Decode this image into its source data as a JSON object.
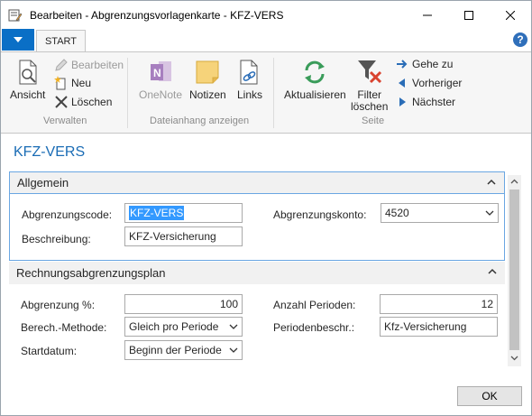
{
  "window": {
    "title": "Bearbeiten - Abgrenzungsvorlagenkarte - KFZ-VERS",
    "minimize_icon": "minimize-icon",
    "maximize_icon": "maximize-icon",
    "close_icon": "close-icon"
  },
  "ribbon": {
    "tabs": [
      {
        "label": "START",
        "active": true
      }
    ],
    "groups": {
      "verwalten": {
        "label": "Verwalten",
        "ansicht": "Ansicht",
        "bearbeiten": "Bearbeiten",
        "neu": "Neu",
        "loeschen": "Löschen"
      },
      "dateianhang": {
        "label": "Dateianhang anzeigen",
        "onenote": "OneNote",
        "notizen": "Notizen",
        "links": "Links"
      },
      "seite": {
        "label": "Seite",
        "aktualisieren": "Aktualisieren",
        "filter_loeschen_line1": "Filter",
        "filter_loeschen_line2": "löschen",
        "gehe_zu": "Gehe zu",
        "vorheriger": "Vorheriger",
        "naechster": "Nächster"
      }
    }
  },
  "page": {
    "title": "KFZ-VERS"
  },
  "sections": {
    "allgemein": {
      "header": "Allgemein",
      "abgrenzungscode_label": "Abgrenzungscode:",
      "abgrenzungscode_value": "KFZ-VERS",
      "beschreibung_label": "Beschreibung:",
      "beschreibung_value": "KFZ-Versicherung",
      "abgrenzungskonto_label": "Abgrenzungskonto:",
      "abgrenzungskonto_value": "4520"
    },
    "plan": {
      "header": "Rechnungsabgrenzungsplan",
      "abgrenzung_label": "Abgrenzung %:",
      "abgrenzung_value": "100",
      "berech_label": "Berech.-Methode:",
      "berech_value": "Gleich pro Periode",
      "startdatum_label": "Startdatum:",
      "startdatum_value": "Beginn der Periode",
      "anzahl_label": "Anzahl Perioden:",
      "anzahl_value": "12",
      "periodenbeschr_label": "Periodenbeschr.:",
      "periodenbeschr_value": "Kfz-Versicherung"
    }
  },
  "footer": {
    "ok_label": "OK"
  },
  "colors": {
    "accent_blue": "#0a6fc6",
    "title_blue": "#1a6cb5",
    "section_border": "#6aa6e2"
  }
}
